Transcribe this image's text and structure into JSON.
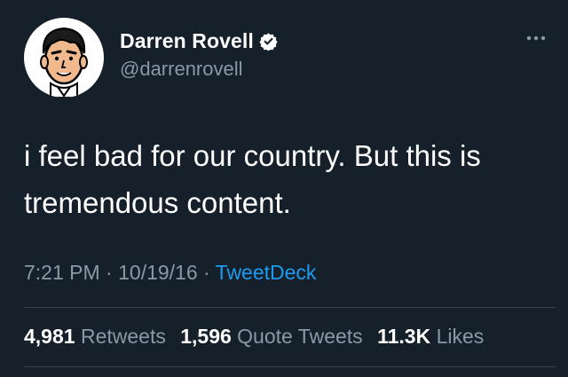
{
  "author": {
    "display_name": "Darren Rovell",
    "handle": "@darrenrovell",
    "avatar_icon": "cartoon-face-avatar",
    "verified_icon": "verified-badge-icon"
  },
  "tweet": {
    "text_line1": "i feel bad for our country. But this is",
    "text_line2": "tremendous content.",
    "time": "7:21 PM",
    "separator1": " · ",
    "date": "10/19/16",
    "separator2": " · ",
    "source": "TweetDeck"
  },
  "stats": {
    "retweets_count": "4,981",
    "retweets_label": "Retweets",
    "quotes_count": "1,596",
    "quotes_label": "Quote Tweets",
    "likes_count": "11.3K",
    "likes_label": "Likes"
  },
  "colors": {
    "background": "#15202b",
    "primary_text": "#ffffff",
    "secondary_text": "#8b98a5",
    "accent": "#1d9bf0",
    "divider": "#38444d"
  }
}
